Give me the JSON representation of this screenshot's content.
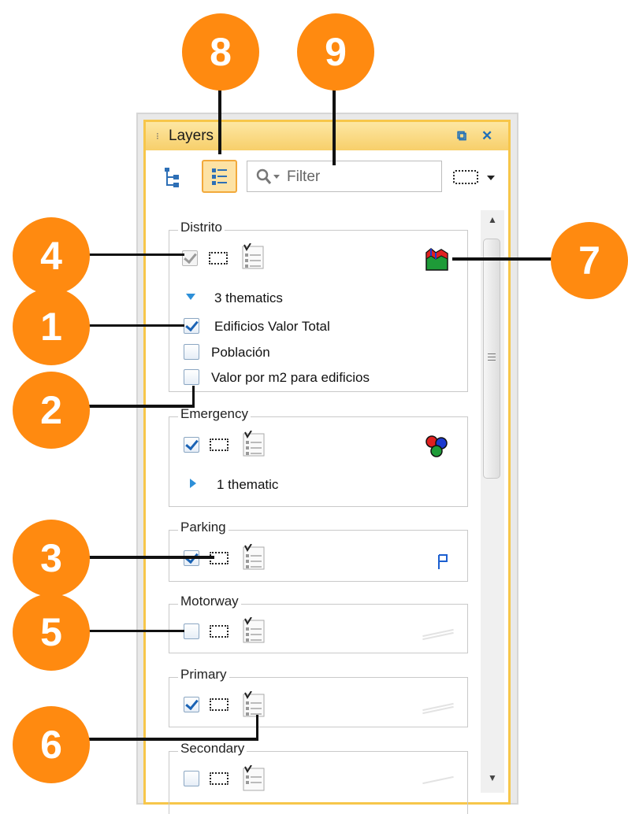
{
  "panel": {
    "title": "Layers",
    "grip": "⁝",
    "restore_icon": "⧉",
    "close_icon": "✕"
  },
  "toolbar": {
    "filter_placeholder": "Filter"
  },
  "groups": [
    {
      "name": "Distrito",
      "visible": true,
      "thematics_label": "3 thematics",
      "expanded": true,
      "thematics": [
        {
          "label": "Edificios Valor Total",
          "checked": true
        },
        {
          "label": "Población",
          "checked": false
        },
        {
          "label": "Valor por m2 para edificios",
          "checked": false
        }
      ]
    },
    {
      "name": "Emergency",
      "visible": true,
      "thematics_label": "1 thematic",
      "expanded": false
    },
    {
      "name": "Parking",
      "visible": true
    },
    {
      "name": "Motorway",
      "visible": false
    },
    {
      "name": "Primary",
      "visible": true
    },
    {
      "name": "Secondary",
      "visible": false
    }
  ],
  "callouts": [
    "8",
    "9",
    "4",
    "7",
    "1",
    "2",
    "3",
    "5",
    "6"
  ],
  "colors": {
    "callout": "#ff8a10",
    "title_bar": "#f7cf6a",
    "accent_blue": "#2d8fd8"
  }
}
